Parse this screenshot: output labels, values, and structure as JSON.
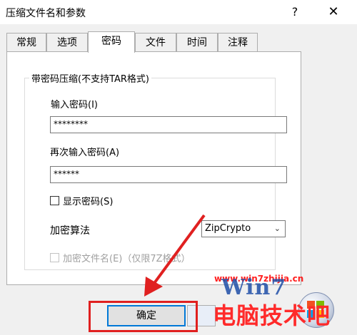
{
  "window": {
    "title": "压缩文件名和参数",
    "help_label": "?",
    "close_label": "✕"
  },
  "tabs": [
    {
      "label": "常规"
    },
    {
      "label": "选项"
    },
    {
      "label": "密码"
    },
    {
      "label": "文件"
    },
    {
      "label": "时间"
    },
    {
      "label": "注释"
    }
  ],
  "active_tab": "密码",
  "group": {
    "legend": "带密码压缩(不支持TAR格式)",
    "enter_password_label": "输入密码(I)",
    "enter_password_value": "********",
    "reenter_password_label": "再次输入密码(A)",
    "reenter_password_value": "******",
    "show_password_label": "显示密码(S)",
    "show_password_checked": false,
    "encryption_label": "加密算法",
    "encryption_value": "ZipCrypto",
    "encrypt_filenames_label": "加密文件名(E)（仅限7Z格式）",
    "encrypt_filenames_checked": false,
    "encrypt_filenames_enabled": false
  },
  "buttons": {
    "ok_label": "确定"
  },
  "watermark": {
    "url": "www.win7zhijia.cn",
    "brand_text": "Win7",
    "chinese_text": "电脑技术吧"
  },
  "colors": {
    "highlight_red": "#e02020",
    "default_button_border": "#0078d7",
    "watermark_red": "#ff2a2a"
  }
}
